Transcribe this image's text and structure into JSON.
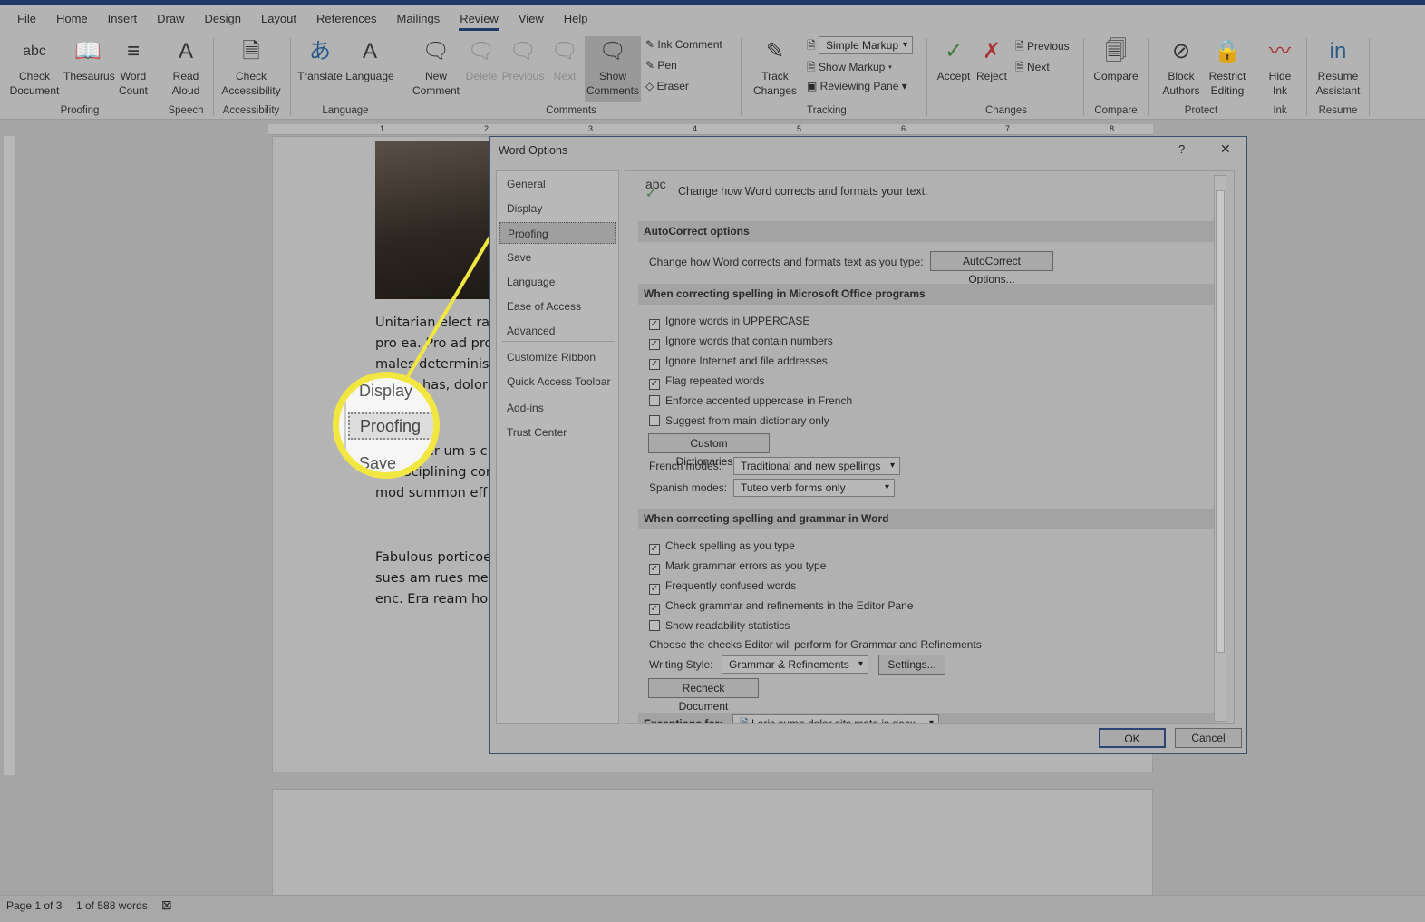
{
  "ribbon_tabs": [
    "File",
    "Home",
    "Insert",
    "Draw",
    "Design",
    "Layout",
    "References",
    "Mailings",
    "Review",
    "View",
    "Help"
  ],
  "active_tab": "Review",
  "ribbon": {
    "check_document": "Check Document",
    "thesaurus": "Thesaurus",
    "word_count": "Word Count",
    "proofing": "Proofing",
    "read_aloud": "Read Aloud",
    "speech": "Speech",
    "check_accessibility": "Check Accessibility",
    "accessibility": "Accessibility",
    "translate": "Translate",
    "language_btn": "Language",
    "language": "Language",
    "new_comment": "New Comment",
    "delete": "Delete",
    "previous": "Previous",
    "next": "Next",
    "show_comments": "Show Comments",
    "ink_comment": "Ink Comment",
    "pen": "Pen",
    "eraser": "Eraser",
    "comments": "Comments",
    "track_changes": "Track Changes",
    "markup_select": "Simple Markup",
    "show_markup": "Show Markup",
    "reviewing_pane": "Reviewing Pane",
    "tracking": "Tracking",
    "accept": "Accept",
    "reject": "Reject",
    "change_previous": "Previous",
    "change_next": "Next",
    "changes": "Changes",
    "compare_btn": "Compare",
    "compare": "Compare",
    "block_authors": "Block Authors",
    "restrict_editing": "Restrict Editing",
    "protect": "Protect",
    "hide_ink": "Hide Ink",
    "ink": "Ink",
    "resume_assistant": "Resume Assistant",
    "resume": "Resume"
  },
  "document": {
    "paragraphs": [
      [
        "Unitarian elect ra",
        "pro ea. Pro ad pro",
        "males determinist",
        "has, dolor"
      ],
      [
        "er um s c",
        "isciplining cor",
        "mod summon eff"
      ],
      [
        "Fabulous porticoe",
        "sues am rues mer",
        "enc. Era ream hor"
      ]
    ]
  },
  "callout": {
    "items": [
      "Display",
      "Proofing",
      "Save"
    ],
    "color": "#f2e640"
  },
  "status": {
    "page": "Page 1 of 3",
    "words": "1 of 588 words"
  },
  "dialog": {
    "title": "Word Options",
    "help": "?",
    "close": "✕",
    "nav": [
      "General",
      "Display",
      "Proofing",
      "Save",
      "Language",
      "Ease of Access",
      "Advanced",
      "Customize Ribbon",
      "Quick Access Toolbar",
      "Add-ins",
      "Trust Center"
    ],
    "selected_nav": "Proofing",
    "header_icon": "abc",
    "header_text": "Change how Word corrects and formats your text.",
    "autocorrect_section": "AutoCorrect options",
    "autocorrect_label": "Change how Word corrects and formats text as you type:",
    "autocorrect_button": "AutoCorrect Options...",
    "office_section": "When correcting spelling in Microsoft Office programs",
    "office_checks": [
      {
        "label": "Ignore words in UPPERCASE",
        "checked": true
      },
      {
        "label": "Ignore words that contain numbers",
        "checked": true
      },
      {
        "label": "Ignore Internet and file addresses",
        "checked": true
      },
      {
        "label": "Flag repeated words",
        "checked": true
      },
      {
        "label": "Enforce accented uppercase in French",
        "checked": false
      },
      {
        "label": "Suggest from main dictionary only",
        "checked": false
      }
    ],
    "custom_dictionaries": "Custom Dictionaries...",
    "french_label": "French modes:",
    "french_value": "Traditional and new spellings",
    "spanish_label": "Spanish modes:",
    "spanish_value": "Tuteo verb forms only",
    "word_section": "When correcting spelling and grammar in Word",
    "word_checks": [
      {
        "label": "Check spelling as you type",
        "checked": true
      },
      {
        "label": "Mark grammar errors as you type",
        "checked": true
      },
      {
        "label": "Frequently confused words",
        "checked": true
      },
      {
        "label": "Check grammar and refinements in the Editor Pane",
        "checked": true
      },
      {
        "label": "Show readability statistics",
        "checked": false
      }
    ],
    "editor_text": "Choose the checks Editor will perform for Grammar and Refinements",
    "writing_style_label": "Writing Style:",
    "writing_style_value": "Grammar & Refinements",
    "settings": "Settings...",
    "recheck": "Recheck Document",
    "exceptions_label": "Exceptions for:",
    "exceptions_value": "Loris sump dolor sits mate is.docx",
    "ok": "OK",
    "cancel": "Cancel"
  }
}
